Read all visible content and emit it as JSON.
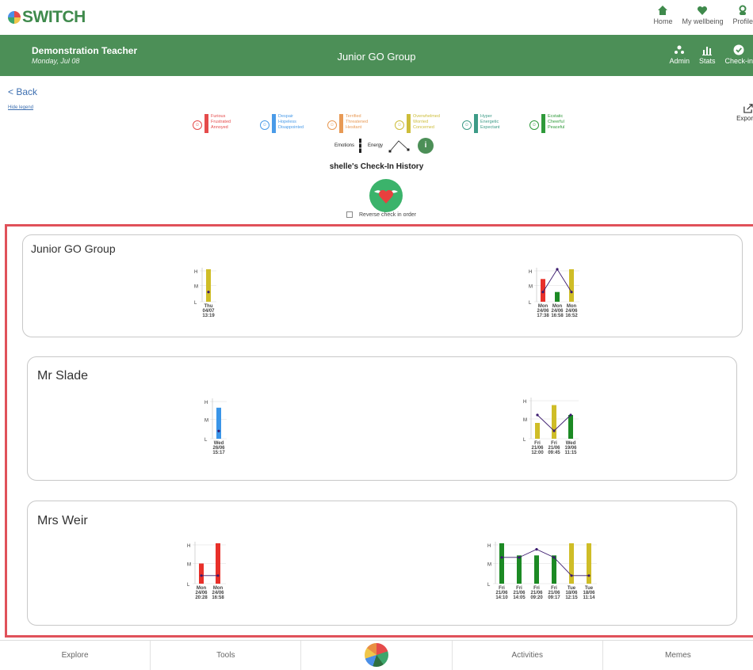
{
  "app": {
    "logo": "SWITCH"
  },
  "topnav": [
    {
      "label": "Home",
      "icon": "home-icon"
    },
    {
      "label": "My wellbeing",
      "icon": "heart-icon"
    },
    {
      "label": "Profile",
      "icon": "user-icon"
    }
  ],
  "header": {
    "teacher": "Demonstration Teacher",
    "date": "Monday, Jul 08",
    "group": "Junior GO Group",
    "nav": [
      {
        "label": "Admin",
        "icon": "admin-icon"
      },
      {
        "label": "Stats",
        "icon": "stats-icon"
      },
      {
        "label": "Check-in",
        "icon": "check-icon"
      }
    ]
  },
  "page": {
    "back": "< Back",
    "hide_legend": "Hide legend",
    "export": "Expor",
    "history_title": "shelle's Check-In History",
    "reverse_label": "Reverse check in order",
    "key_emotions": "Emotions",
    "key_energy": "Energy",
    "info_glyph": "i"
  },
  "legend": [
    {
      "color": "#e54b4b",
      "words": [
        "Furious",
        "Frustrated",
        "Annoyed"
      ]
    },
    {
      "color": "#4a9be8",
      "words": [
        "Despair",
        "Hopeless",
        "Disappointed"
      ]
    },
    {
      "color": "#e89a55",
      "words": [
        "Terrified",
        "Threatened",
        "Hesitant"
      ]
    },
    {
      "color": "#cdbd3a",
      "words": [
        "Overwhelmed",
        "Worried",
        "Concerned"
      ]
    },
    {
      "color": "#3d9b87",
      "words": [
        "Hyper",
        "Energetic",
        "Expectant"
      ]
    },
    {
      "color": "#2f9a3a",
      "words": [
        "Ecstatic",
        "Cheerful",
        "Peaceful"
      ]
    }
  ],
  "colors": {
    "red": "#e8302a",
    "blue": "#3a95e8",
    "yellow": "#cfbd27",
    "green": "#1c8a24",
    "line": "#3b1a6e"
  },
  "cards": [
    {
      "title": "Junior GO Group",
      "chart_data": [
        {
          "type": "bar",
          "ylim": [
            "L",
            "H"
          ],
          "yticks": [
            "H",
            "M",
            "L"
          ],
          "points": [
            {
              "day": "Thu",
              "date": "04/07",
              "time": "13:19",
              "color": "yellow",
              "emotion": 1.0,
              "energy": 0.3
            }
          ]
        },
        {
          "type": "bar",
          "ylim": [
            "L",
            "H"
          ],
          "yticks": [
            "H",
            "M",
            "L"
          ],
          "points": [
            {
              "day": "Mon",
              "date": "24/06",
              "time": "17:38",
              "color": "red",
              "emotion": 0.7,
              "energy": 0.3
            },
            {
              "day": "Mon",
              "date": "24/06",
              "time": "16:58",
              "color": "green",
              "emotion": 0.3,
              "energy": 1.0
            },
            {
              "day": "Mon",
              "date": "24/06",
              "time": "16:52",
              "color": "yellow",
              "emotion": 1.0,
              "energy": 0.3
            }
          ]
        }
      ]
    },
    {
      "title": "Mr Slade",
      "chart_data": [
        {
          "type": "bar",
          "ylim": [
            "L",
            "H"
          ],
          "yticks": [
            "H",
            "M",
            "L"
          ],
          "points": [
            {
              "day": "Wed",
              "date": "26/06",
              "time": "15:17",
              "color": "blue",
              "emotion": 0.8,
              "energy": 0.2
            }
          ]
        },
        {
          "type": "bar",
          "ylim": [
            "L",
            "H"
          ],
          "yticks": [
            "H",
            "M",
            "L"
          ],
          "points": [
            {
              "day": "Fri",
              "date": "21/06",
              "time": "12:00",
              "color": "yellow",
              "emotion": 0.4,
              "energy": 0.6
            },
            {
              "day": "Fri",
              "date": "21/06",
              "time": "09:45",
              "color": "yellow",
              "emotion": 0.85,
              "energy": 0.2
            },
            {
              "day": "Wed",
              "date": "19/06",
              "time": "11:15",
              "color": "green",
              "emotion": 0.6,
              "energy": 0.6
            }
          ]
        }
      ]
    },
    {
      "title": "Mrs Weir",
      "chart_data": [
        {
          "type": "bar",
          "ylim": [
            "L",
            "H"
          ],
          "yticks": [
            "H",
            "M",
            "L"
          ],
          "points": [
            {
              "day": "Mon",
              "date": "24/06",
              "time": "20:28",
              "color": "red",
              "emotion": 0.5,
              "energy": 0.2
            },
            {
              "day": "Mon",
              "date": "24/06",
              "time": "16:58",
              "color": "red",
              "emotion": 1.0,
              "energy": 0.2
            }
          ]
        },
        {
          "type": "bar",
          "ylim": [
            "L",
            "H"
          ],
          "yticks": [
            "H",
            "M",
            "L"
          ],
          "points": [
            {
              "day": "Fri",
              "date": "21/06",
              "time": "14:10",
              "color": "green",
              "emotion": 1.0,
              "energy": 0.65
            },
            {
              "day": "Fri",
              "date": "21/06",
              "time": "14:05",
              "color": "green",
              "emotion": 0.7,
              "energy": 0.65
            },
            {
              "day": "Fri",
              "date": "21/06",
              "time": "09:20",
              "color": "green",
              "emotion": 0.7,
              "energy": 0.85
            },
            {
              "day": "Fri",
              "date": "21/06",
              "time": "09:17",
              "color": "green",
              "emotion": 0.7,
              "energy": 0.65
            },
            {
              "day": "Tue",
              "date": "18/06",
              "time": "12:15",
              "color": "yellow",
              "emotion": 1.0,
              "energy": 0.2
            },
            {
              "day": "Tue",
              "date": "18/06",
              "time": "11:14",
              "color": "yellow",
              "emotion": 1.0,
              "energy": 0.2
            }
          ]
        }
      ]
    }
  ],
  "bottomnav": [
    "Explore",
    "Tools",
    "",
    "Activities",
    "Memes"
  ]
}
